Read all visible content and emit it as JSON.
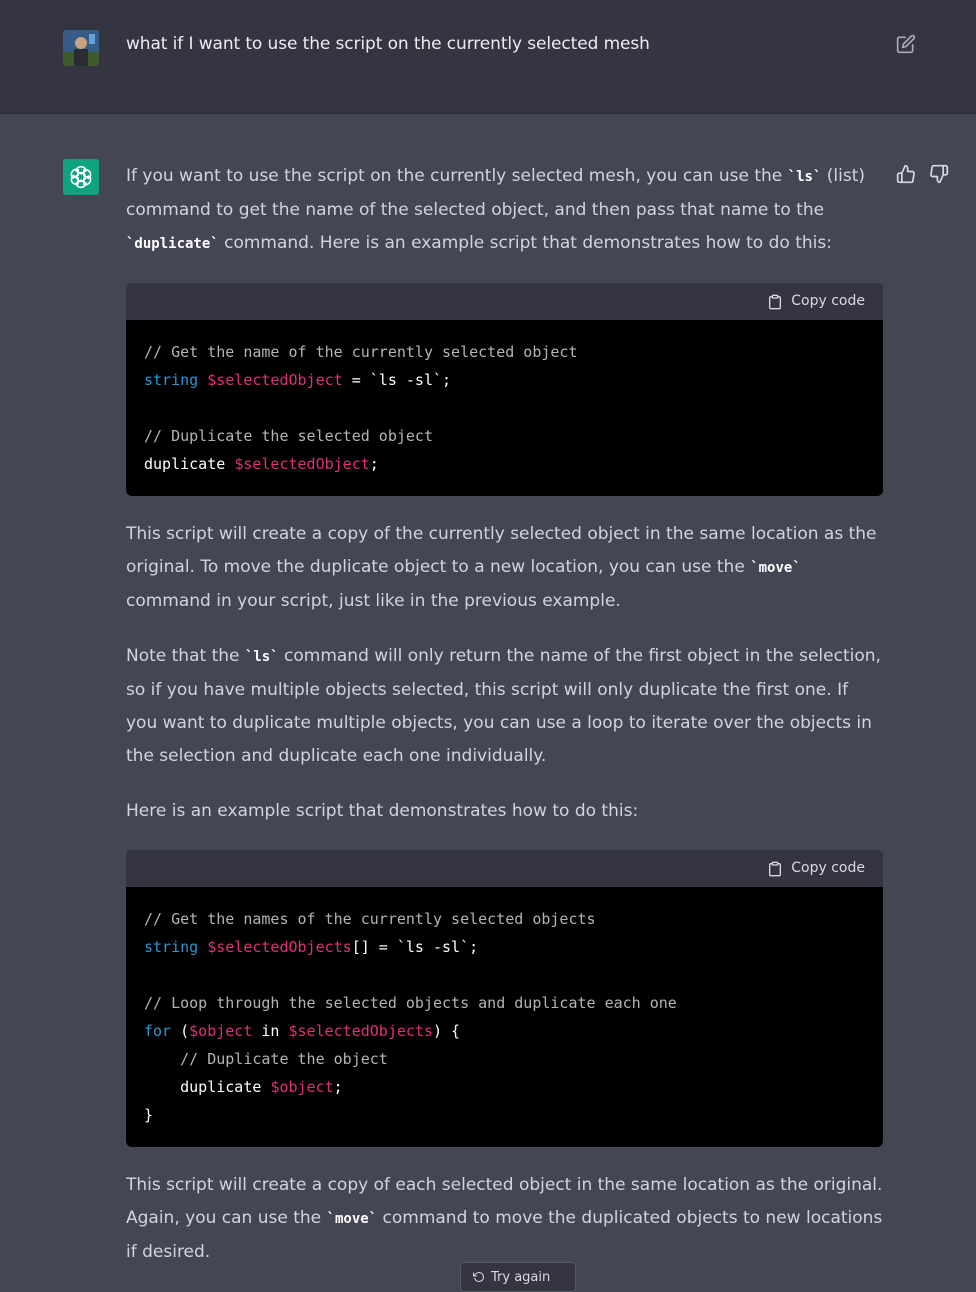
{
  "user": {
    "message": "what if I want to use the script on the currently selected mesh"
  },
  "assistant": {
    "p1": {
      "a": "If you want to use the script on the currently selected mesh, you can use the ",
      "code1": "`ls`",
      "b": " (list) command to get the name of the selected object, and then pass that name to the ",
      "code2": "`duplicate`",
      "c": " command. Here is an example script that demonstrates how to do this:"
    },
    "code1": {
      "copy_label": "Copy code",
      "l1": "// Get the name of the currently selected object",
      "l2_kw": "string",
      "l2_var": "$selectedObject",
      "l2_rest": " = `ls -sl`;",
      "l4": "// Duplicate the selected object",
      "l5_cmd": "duplicate ",
      "l5_var": "$selectedObject",
      "l5_end": ";"
    },
    "p2": {
      "a": "This script will create a copy of the currently selected object in the same location as the original. To move the duplicate object to a new location, you can use the ",
      "code": "`move`",
      "b": " command in your script, just like in the previous example."
    },
    "p3": {
      "a": "Note that the ",
      "code": "`ls`",
      "b": " command will only return the name of the first object in the selection, so if you have multiple objects selected, this script will only duplicate the first one. If you want to duplicate multiple objects, you can use a loop to iterate over the objects in the selection and duplicate each one individually."
    },
    "p4": "Here is an example script that demonstrates how to do this:",
    "code2": {
      "copy_label": "Copy code",
      "l1": "// Get the names of the currently selected objects",
      "l2_kw": "string",
      "l2_var": "$selectedObjects",
      "l2_rest": "[] = `ls -sl`;",
      "l4": "// Loop through the selected objects and duplicate each one",
      "l5_kw": "for",
      "l5_a": " (",
      "l5_var1": "$object",
      "l5_b": " in ",
      "l5_var2": "$selectedObjects",
      "l5_c": ") {",
      "l6": "    // Duplicate the object",
      "l7_cmd": "    duplicate ",
      "l7_var": "$object",
      "l7_end": ";",
      "l8": "}"
    },
    "p5": {
      "a": "This script will create a copy of each selected object in the same location as the original. Again, you can use the ",
      "code": "`move`",
      "b": " command to move the duplicated objects to new locations if desired."
    }
  },
  "regenerate": {
    "label": "Try again"
  },
  "colors": {
    "page_bg": "#444654",
    "user_bg": "#343541",
    "accent": "#10a37f",
    "code_bg": "#000000",
    "keyword": "#2e95d3",
    "variable": "#df3079"
  }
}
